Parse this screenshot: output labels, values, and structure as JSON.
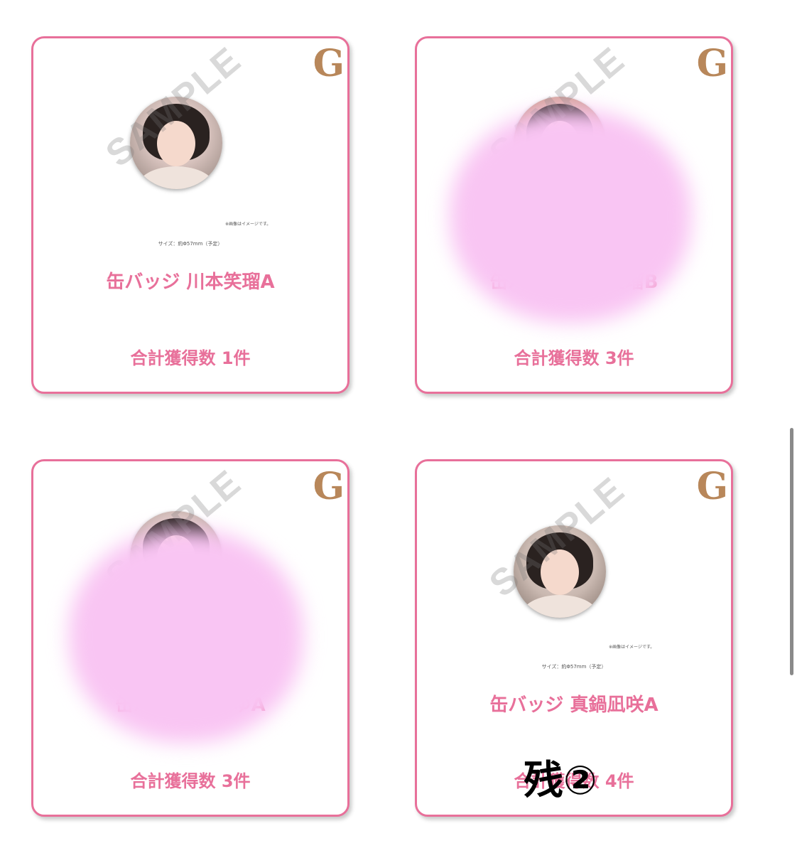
{
  "logo_letter": "G",
  "watermark": "SAMPLE",
  "cards": [
    {
      "image_note": "※画像はイメージです。",
      "size_text": "サイズ：約Φ57mm（予定）",
      "title": "缶バッジ 川本笑瑠A",
      "count": "合計獲得数 1件"
    },
    {
      "title": "缶バッジ 川本笑瑠B",
      "count": "合計獲得数 3件",
      "obscured": true
    },
    {
      "title": "缶バッジ 田みゆA",
      "count": "合計獲得数 3件",
      "obscured": true
    },
    {
      "image_note": "※画像はイメージです。",
      "size_text": "サイズ：約Φ57mm（予定）",
      "title": "缶バッジ 真鍋凪咲A",
      "count": "合計獲得数 4件",
      "overlay_text": "残②"
    }
  ],
  "colors": {
    "accent": "#e8709a",
    "logo": "#b8875a",
    "blur": "#f9c5f3"
  }
}
